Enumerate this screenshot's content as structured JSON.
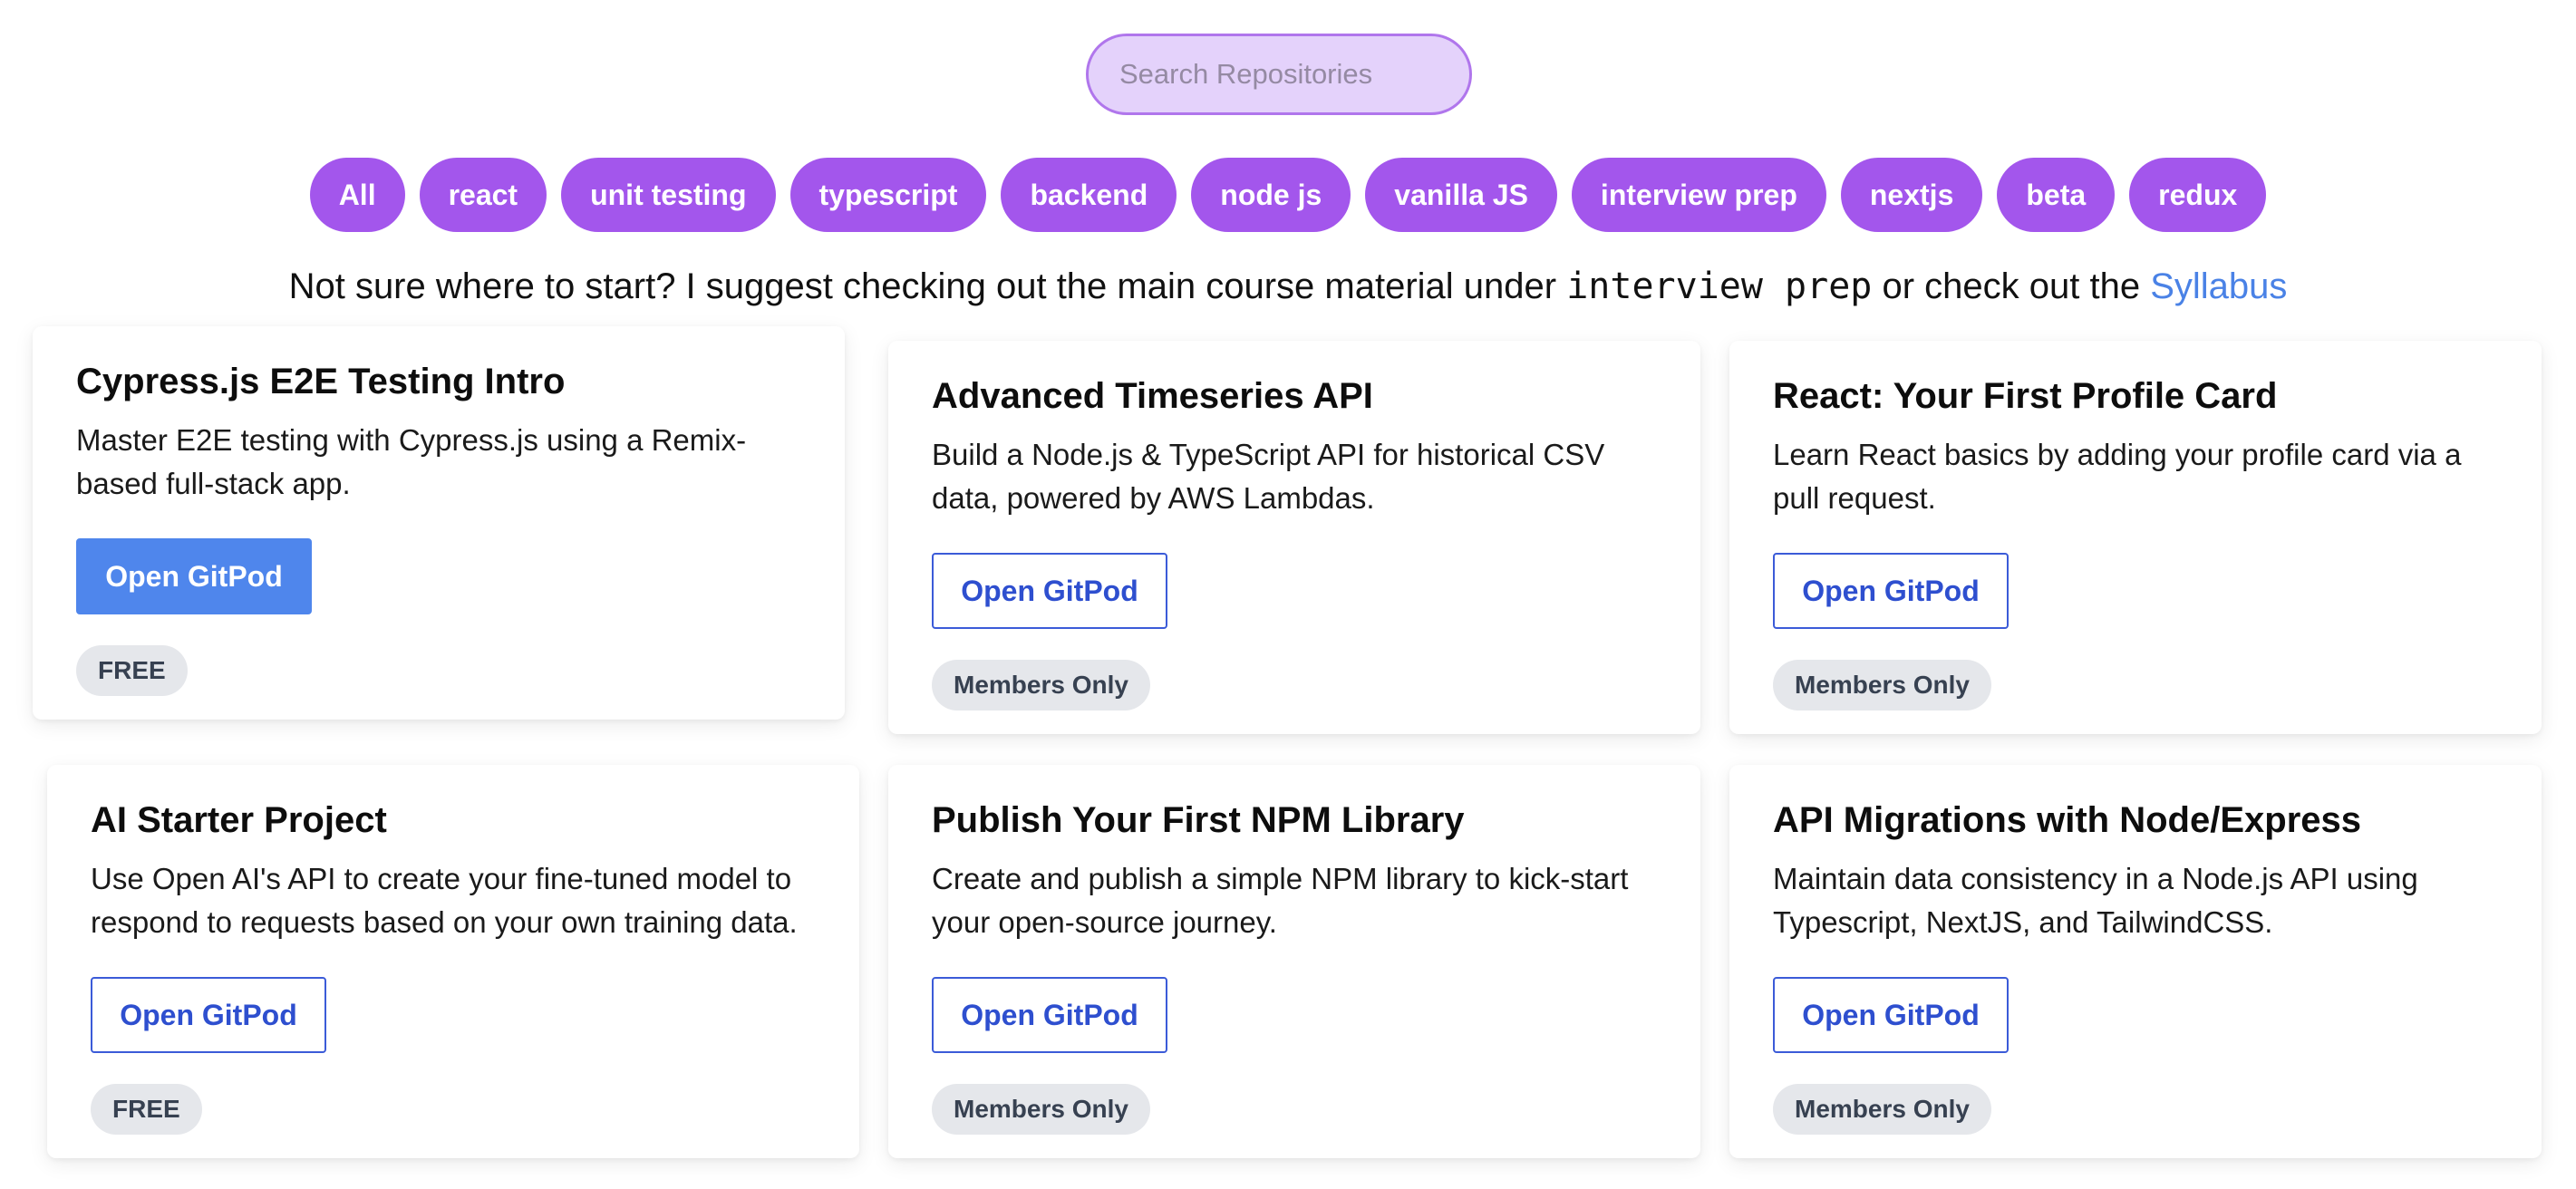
{
  "search": {
    "placeholder": "Search Repositories",
    "value": ""
  },
  "tags": [
    "All",
    "react",
    "unit testing",
    "typescript",
    "backend",
    "node js",
    "vanilla JS",
    "interview prep",
    "nextjs",
    "beta",
    "redux"
  ],
  "hint": {
    "prefix": "Not sure where to start? I suggest checking out the main course material under",
    "code": "interview prep",
    "middle": "or check out the",
    "link": "Syllabus"
  },
  "cards": [
    {
      "title": "Cypress.js E2E Testing Intro",
      "description": "Master E2E testing with Cypress.js using a Remix-based full-stack app.",
      "button": "Open GitPod",
      "badge": "FREE"
    },
    {
      "title": "Advanced Timeseries API",
      "description": "Build a Node.js & TypeScript API for historical CSV data, powered by AWS Lambdas.",
      "button": "Open GitPod",
      "badge": "Members Only"
    },
    {
      "title": "React: Your First Profile Card",
      "description": "Learn React basics by adding your profile card via a pull request.",
      "button": "Open GitPod",
      "badge": "Members Only"
    },
    {
      "title": "AI Starter Project",
      "description": "Use Open AI's API to create your fine-tuned model to respond to requests based on your own training data.",
      "button": "Open GitPod",
      "badge": "FREE"
    },
    {
      "title": "Publish Your First NPM Library",
      "description": "Create and publish a simple NPM library to kick-start your open-source journey.",
      "button": "Open GitPod",
      "badge": "Members Only"
    },
    {
      "title": "API Migrations with Node/Express",
      "description": "Maintain data consistency in a Node.js API using Typescript, NextJS, and TailwindCSS.",
      "button": "Open GitPod",
      "badge": "Members Only"
    }
  ],
  "colors": {
    "tag": "#a356ec",
    "search_bg": "#e4d2fb",
    "link": "#4a82e6",
    "primary_button": "#4f86ec",
    "outline_button": "#2e4fcf",
    "badge_bg": "#e5e7eb"
  }
}
